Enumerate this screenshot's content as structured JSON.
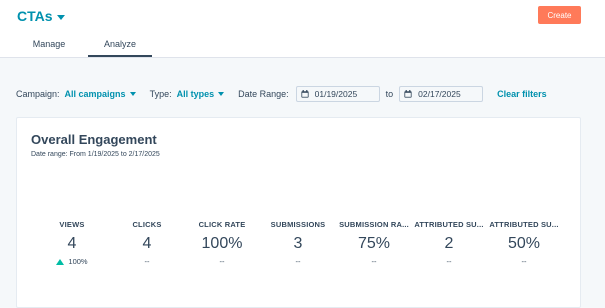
{
  "header": {
    "app_title": "CTAs",
    "create_label": "Create"
  },
  "tabs": [
    {
      "label": "Manage",
      "active": false
    },
    {
      "label": "Analyze",
      "active": true
    }
  ],
  "filters": {
    "campaign_label": "Campaign:",
    "campaign_value": "All campaigns",
    "type_label": "Type:",
    "type_value": "All types",
    "date_range_label": "Date Range:",
    "date_from": "01/19/2025",
    "to_label": "to",
    "date_to": "02/17/2025",
    "clear_label": "Clear filters"
  },
  "card": {
    "title": "Overall Engagement",
    "subtitle": "Date range: From 1/19/2025 to 2/17/2025"
  },
  "metrics": [
    {
      "label": "VIEWS",
      "value": "4",
      "change": "100%"
    },
    {
      "label": "CLICKS",
      "value": "4",
      "change": "--"
    },
    {
      "label": "CLICK RATE",
      "value": "100%",
      "change": "--"
    },
    {
      "label": "SUBMISSIONS",
      "value": "3",
      "change": "--"
    },
    {
      "label": "SUBMISSION RA...",
      "value": "75%",
      "change": "--"
    },
    {
      "label": "ATTRIBUTED SU...",
      "value": "2",
      "change": "--"
    },
    {
      "label": "ATTRIBUTED SU...",
      "value": "50%",
      "change": "--"
    }
  ],
  "colors": {
    "accent": "#0091ae",
    "create_button": "#ff7a59",
    "positive": "#00bda5",
    "text": "#33475b"
  }
}
